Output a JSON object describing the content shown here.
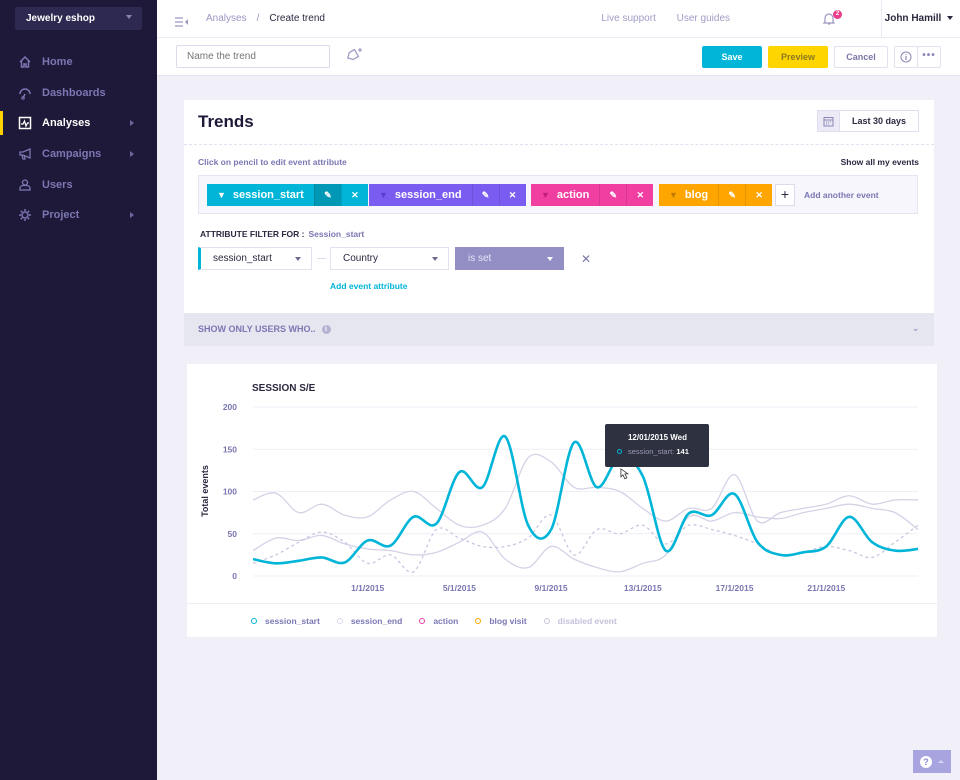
{
  "sidebar": {
    "workspace": "Jewelry eshop",
    "items": [
      {
        "label": "Home",
        "icon": "home-icon",
        "active": false,
        "has_arrow": false
      },
      {
        "label": "Dashboards",
        "icon": "dashboard-icon",
        "active": false,
        "has_arrow": false
      },
      {
        "label": "Analyses",
        "icon": "analyses-icon",
        "active": true,
        "has_arrow": true
      },
      {
        "label": "Campaigns",
        "icon": "megaphone-icon",
        "active": false,
        "has_arrow": true
      },
      {
        "label": "Users",
        "icon": "users-icon",
        "active": false,
        "has_arrow": false
      },
      {
        "label": "Project",
        "icon": "gear-icon",
        "active": false,
        "has_arrow": true
      }
    ]
  },
  "header": {
    "breadcrumb_parent": "Analyses",
    "breadcrumb_sep": "/",
    "breadcrumb_current": "Create trend",
    "live_support": "Live support",
    "user_guides": "User guides",
    "notification_count": "2",
    "user_name": "John Hamill"
  },
  "toolbar": {
    "name_placeholder": "Name the trend",
    "save_label": "Save",
    "preview_label": "Preview",
    "cancel_label": "Cancel",
    "info_label": "i",
    "more_label": "•••"
  },
  "trends": {
    "title": "Trends",
    "date_range": "Last 30 days",
    "hint": "Click on pencil to edit event attribute",
    "show_all": "Show all my events",
    "events": [
      {
        "label": "session_start",
        "color": "#00b5d8"
      },
      {
        "label": "session_end",
        "color": "#7b5cf0"
      },
      {
        "label": "action",
        "color": "#f13ea1"
      },
      {
        "label": "blog",
        "color": "#ffa500"
      }
    ],
    "add_event": "Add another event",
    "filter_label": "ATTRIBUTE FILTER FOR :",
    "filter_event": "Session_start",
    "filter_event_select": "session_start",
    "filter_attr_select": "Country",
    "filter_op_select": "is set",
    "add_attribute": "Add event attribute",
    "show_only": "SHOW ONLY USERS WHO.."
  },
  "chart_data": {
    "type": "line",
    "title": "SESSION S/E",
    "xlabel": "",
    "ylabel": "Total events",
    "ylim": [
      0,
      200
    ],
    "yticks": [
      "0",
      "50",
      "100",
      "150",
      "200"
    ],
    "xtick_labels": [
      "1/1/2015",
      "5/1/2015",
      "9/1/2015",
      "13/1/2015",
      "17/1/2015",
      "21/1/2015"
    ],
    "grid": true,
    "legend_position": "bottom",
    "x_days": [
      -4,
      -3,
      -2,
      -1,
      0,
      1,
      2,
      3,
      4,
      5,
      6,
      7,
      8,
      9,
      10,
      11,
      12,
      13,
      14,
      15,
      16,
      17,
      18,
      19,
      20,
      21,
      22,
      23,
      24,
      25
    ],
    "series": [
      {
        "name": "session_start",
        "color": "#00b5d8",
        "style": "solid-bold",
        "values": [
          20,
          15,
          18,
          22,
          16,
          42,
          36,
          70,
          62,
          123,
          105,
          165,
          60,
          55,
          158,
          105,
          141,
          118,
          30,
          74,
          72,
          97,
          40,
          25,
          28,
          35,
          70,
          40,
          30,
          32
        ]
      },
      {
        "name": "session_end",
        "color": "#c9c6e0",
        "style": "dashed",
        "values": [
          15,
          25,
          40,
          52,
          40,
          15,
          25,
          5,
          55,
          45,
          35,
          35,
          45,
          72,
          25,
          55,
          50,
          60,
          38,
          60,
          55,
          48,
          38,
          25,
          28,
          35,
          30,
          22,
          40,
          60
        ]
      },
      {
        "name": "action",
        "color": "#d4d2e6",
        "style": "solid",
        "values": [
          90,
          98,
          75,
          85,
          72,
          70,
          90,
          100,
          80,
          60,
          60,
          80,
          140,
          135,
          105,
          105,
          100,
          80,
          65,
          80,
          80,
          120,
          65,
          75,
          80,
          85,
          95,
          85,
          90,
          90
        ]
      },
      {
        "name": "blog visit",
        "color": "#d4d2e6",
        "style": "solid",
        "values": [
          30,
          45,
          42,
          48,
          38,
          32,
          30,
          25,
          28,
          40,
          52,
          20,
          10,
          35,
          20,
          10,
          5,
          15,
          25,
          70,
          65,
          75,
          70,
          68,
          75,
          80,
          85,
          80,
          75,
          55
        ]
      }
    ],
    "legend": [
      {
        "label": "session_start",
        "color": "#00b5d8"
      },
      {
        "label": "session_end",
        "color": "#b7b4e4"
      },
      {
        "label": "action",
        "color": "#f13ea1"
      },
      {
        "label": "blog visit",
        "color": "#ffa500"
      },
      {
        "label": "disabled event",
        "color": "#c9c7dd"
      }
    ],
    "tooltip": {
      "date": "12/01/2015  Wed",
      "series": "session_start:",
      "value": "141"
    }
  }
}
